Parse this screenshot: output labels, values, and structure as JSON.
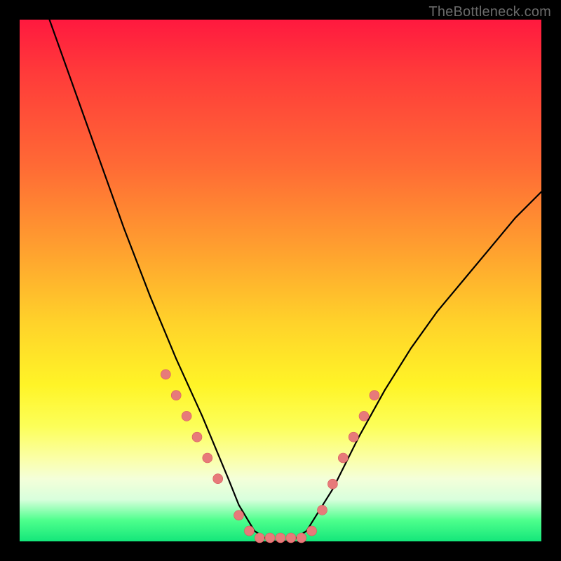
{
  "watermark": "TheBottleneck.com",
  "colors": {
    "frame_bg": "#000000",
    "curve": "#000000",
    "marker_fill": "#e77a7a",
    "marker_stroke": "#d85959",
    "gradient_top": "#ff193f",
    "gradient_bottom": "#14e67a"
  },
  "chart_data": {
    "type": "line",
    "title": "",
    "xlabel": "",
    "ylabel": "",
    "xlim": [
      0,
      100
    ],
    "ylim": [
      0,
      100
    ],
    "grid": false,
    "legend": false,
    "series": [
      {
        "name": "bottleneck-curve",
        "x": [
          0,
          5,
          10,
          15,
          20,
          25,
          30,
          35,
          40,
          42,
          45,
          48,
          50,
          52,
          55,
          60,
          65,
          70,
          75,
          80,
          85,
          90,
          95,
          100
        ],
        "values": [
          110,
          102,
          88,
          74,
          60,
          47,
          35,
          24,
          12,
          7,
          2,
          0,
          0,
          0,
          2,
          10,
          20,
          29,
          37,
          44,
          50,
          56,
          62,
          67
        ]
      }
    ],
    "markers": {
      "name": "highlighted-points",
      "x": [
        28,
        30,
        32,
        34,
        36,
        38,
        42,
        44,
        46,
        48,
        50,
        52,
        54,
        56,
        58,
        60,
        62,
        64,
        66,
        68
      ],
      "values": [
        32,
        28,
        24,
        20,
        16,
        12,
        5,
        2,
        0,
        0,
        0,
        0,
        0,
        2,
        6,
        11,
        16,
        20,
        24,
        28
      ]
    }
  }
}
